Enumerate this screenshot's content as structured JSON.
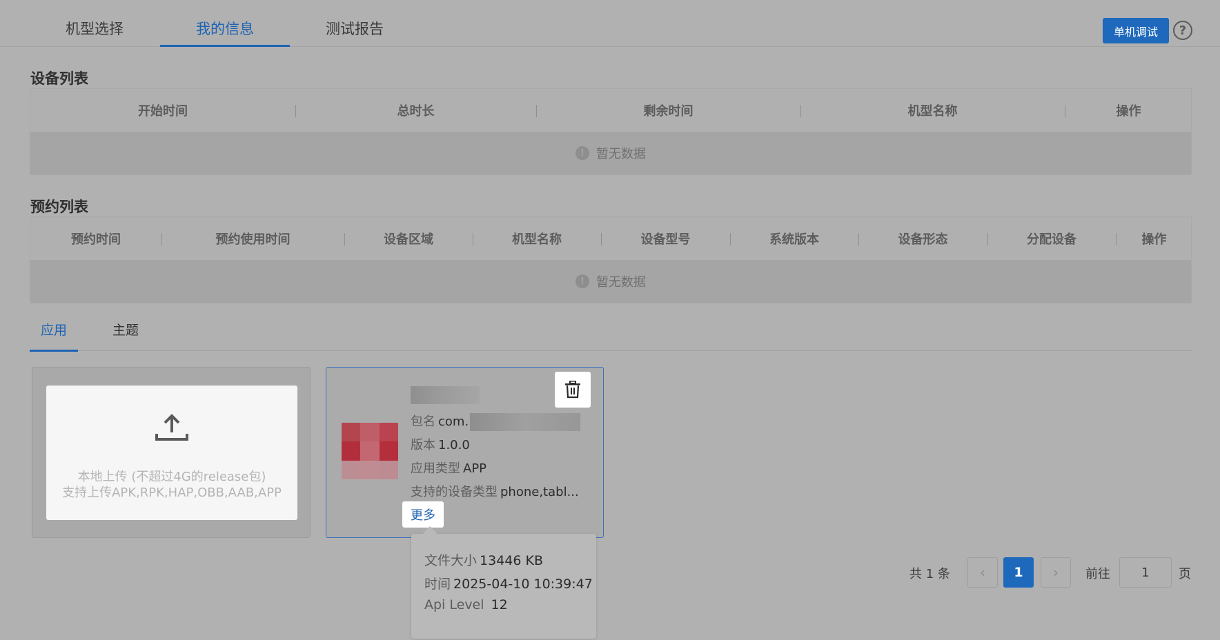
{
  "top_tabs": [
    "机型选择",
    "我的信息",
    "测试报告"
  ],
  "debug_button": "单机调试",
  "help_glyph": "?",
  "device_list": {
    "title": "设备列表",
    "columns": [
      "开始时间",
      "总时长",
      "剩余时间",
      "机型名称",
      "操作"
    ],
    "empty": "暂无数据"
  },
  "reservation_list": {
    "title": "预约列表",
    "columns": [
      "预约时间",
      "预约使用时间",
      "设备区域",
      "机型名称",
      "设备型号",
      "系统版本",
      "设备形态",
      "分配设备",
      "操作"
    ],
    "empty": "暂无数据"
  },
  "sub_tabs": [
    "应用",
    "主题"
  ],
  "upload": {
    "line1": "本地上传 (不超过4G的release包)",
    "line2": "支持上传APK,RPK,HAP,OBB,AAB,APP"
  },
  "app": {
    "package_label": "包名",
    "package_value": "com.",
    "version_label": "版本",
    "version_value": "1.0.0",
    "type_label": "应用类型",
    "type_value": "APP",
    "devices_label": "支持的设备类型",
    "devices_value": "phone,tabl...",
    "more": "更多"
  },
  "popover": {
    "size_label": "文件大小",
    "size_value": "13446 KB",
    "time_label": "时间",
    "time_value": "2025-04-10 10:39:47",
    "api_label": "Api Level",
    "api_value": "12"
  },
  "pagination": {
    "total": "共 1 条",
    "prev": "‹",
    "next": "›",
    "current": "1",
    "goto_label": "前往",
    "goto_value": "1",
    "page_label": "页"
  },
  "colors": {
    "accent": "#1f69bd",
    "background": "#b1b1b1"
  }
}
